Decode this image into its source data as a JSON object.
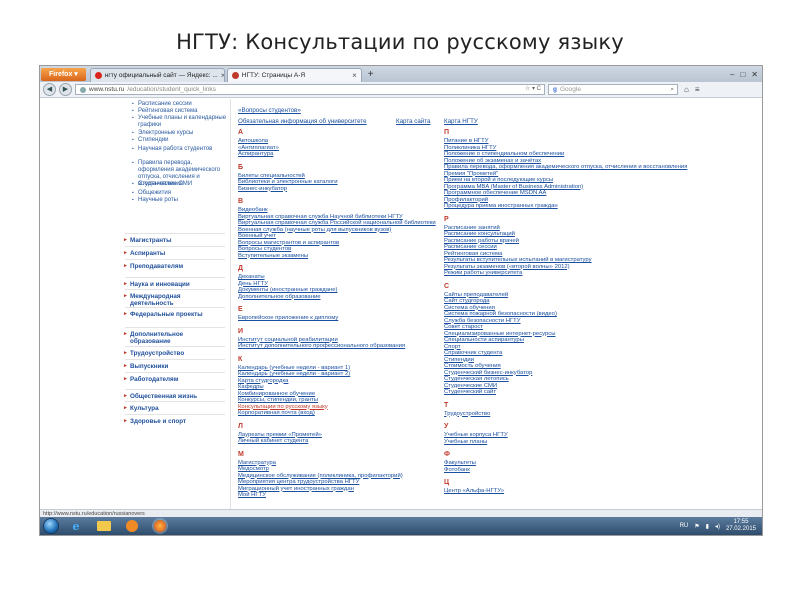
{
  "slide": {
    "title": "НГТУ: Консультации по русскому языку"
  },
  "browser": {
    "menu_button": "Firefox ▾",
    "tabs": [
      {
        "label": "нгту официальный сайт — Яндекс: ..."
      },
      {
        "label": "НГТУ: Страницы А-Я"
      }
    ],
    "new_tab": "+",
    "window_controls": [
      "–",
      "□",
      "✕"
    ],
    "url_host": "www.nstu.ru",
    "url_path": "/education/student_quick_links",
    "url_tail": "☆ ▾ C",
    "search_engine": "g",
    "search_placeholder": "Google",
    "status_url": "http://www.nstu.ru/education/russianovers"
  },
  "sidebar": {
    "subitems": [
      "Расписание сессии",
      "Рейтинговая система",
      "Учебные планы и календарные графики",
      "Электронные курсы",
      "Стипендии",
      "Научная работа студентов",
      "Правила перевода, оформления академического отпуска, отчисления и восстановления",
      "Студенческие СМИ",
      "Общежития",
      "Научные роты"
    ],
    "main_items": [
      "Магистранты",
      "Аспиранты",
      "Преподавателям",
      "Наука и инновации",
      "Международная деятельность",
      "Федеральные проекты",
      "Дополнительное образование",
      "Трудоустройство",
      "Выпускники",
      "Работодателям",
      "Общественная жизнь",
      "Культура",
      "Здоровье и спорт"
    ]
  },
  "top": {
    "questions_link": "«Вопросы студентов»",
    "header_links": [
      "Обязательная информация об университете",
      "Карта сайта",
      "Карта НГТУ"
    ]
  },
  "col1": [
    {
      "letter": "А",
      "links": [
        "Автошкола",
        "«Антиплагиат»",
        "Аспирантура"
      ]
    },
    {
      "letter": "Б",
      "links": [
        "Билеты специальностей",
        "Библиотеки и электронные каталоги",
        "Бизнес-инкубатор"
      ]
    },
    {
      "letter": "В",
      "links": [
        "Видеобанк",
        "Виртуальная справочная служба Научной библиотеки НГТУ",
        "Виртуальная справочная служба Российской национальной библиотеки",
        "Военная служба (научные роты для выпускников вузов)",
        "Военный учет",
        "Вопросы магистрантов и аспирантов",
        "Вопросы студентов",
        "Вступительные экзамены"
      ]
    },
    {
      "letter": "Д",
      "links": [
        "Деканаты",
        "День НГТУ",
        "Документы (иностранные граждане)",
        "Дополнительное образование"
      ]
    },
    {
      "letter": "Е",
      "links": [
        "Европейское приложение к диплому"
      ]
    },
    {
      "letter": "И",
      "links": [
        "Институт социальной реабилитации",
        "Институт дополнительного профессионального образования"
      ]
    },
    {
      "letter": "К",
      "links": [
        "Календарь (учебные недели - вариант 1)",
        "Календарь (учебные недели - вариант 2)",
        "Карта студгородка",
        "Кафедры",
        "Комбинированное обучение",
        "Конкурсы, стипендии, гранты",
        "Консультации по русскому языку",
        "Корпоративная почта (вход)"
      ]
    },
    {
      "letter": "Л",
      "links": [
        "Лауреаты премии «Прометей»",
        "Личный кабинет студента"
      ]
    },
    {
      "letter": "М",
      "links": [
        "Магистратура",
        "Медосмотр",
        "Медицинское обслуживание (поликлиника, профилакторий)",
        "Мероприятия центра трудоустройства НГТУ",
        "Миграционный учет иностранных граждан",
        "Мой НГТУ"
      ]
    }
  ],
  "col2": [
    {
      "letter": "П",
      "links": [
        "Питание в НГТУ",
        "Поликлиника НГТУ",
        "Положение о стипендиальном обеспечении",
        "Положение об экзаменах и зачётах",
        "Правила перевода, оформления академического отпуска, отчисления и восстановления",
        "Премия \"Прометей\"",
        "Прием на второй и последующие курсы",
        "Программа MBA (Master of Business Administration)",
        "Программное обеспечение MSDN AA",
        "Профилакторий",
        "Процедура приема иностранных граждан"
      ]
    },
    {
      "letter": "Р",
      "links": [
        "Расписание занятий",
        "Расписание консультаций",
        "Расписание работы врачей",
        "Расписание сессии",
        "Рейтинговая система",
        "Результаты вступительных испытаний в магистратуру",
        "Результаты экзаменов («второй волны» 2012)",
        "Режим работы университета"
      ]
    },
    {
      "letter": "С",
      "links": [
        "Сайты преподавателей",
        "Сайт студгорода",
        "Система обучения",
        "Система пожарной безопасности (видео)",
        "Служба безопасности НГТУ",
        "Совет старост",
        "Специализированные интернет-ресурсы",
        "Специальности аспирантуры",
        "Спорт",
        "Справочник студента",
        "Стипендии",
        "Стоимость обучения",
        "Студенческий бизнес-инкубатор",
        "Студенческая летопись",
        "Студенческие СМИ",
        "Студенческий сайт"
      ]
    },
    {
      "letter": "Т",
      "links": [
        "Трудоустройство"
      ]
    },
    {
      "letter": "У",
      "links": [
        "Учебные корпуса НГТУ",
        "Учебные планы"
      ]
    },
    {
      "letter": "Ф",
      "links": [
        "Факультеты",
        "Фотобанк"
      ]
    },
    {
      "letter": "Ц",
      "links": [
        "Центр «Альфа-НГТУ»"
      ]
    }
  ],
  "taskbar": {
    "lang": "RU",
    "time": "17:55",
    "date": "27.02.2015"
  }
}
